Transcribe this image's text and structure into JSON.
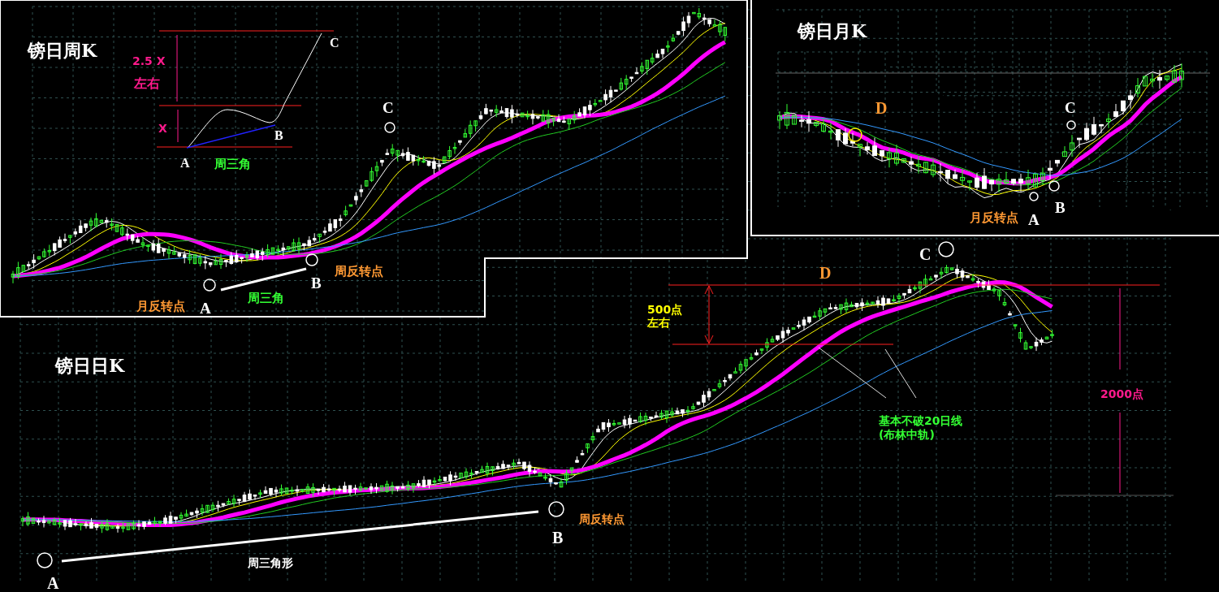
{
  "weekly_chart": {
    "title": "镑日周K",
    "diagram_labels": [
      {
        "text": "2.5 X",
        "color": "#ff1a8c"
      },
      {
        "text": "左右",
        "color": "#ff1a8c"
      },
      {
        "text": "X",
        "color": "#ff1a8c"
      },
      {
        "text": "A",
        "color": "#ffffff"
      },
      {
        "text": "B",
        "color": "#ffffff"
      },
      {
        "text": "C",
        "color": "#ffffff"
      },
      {
        "text": "周三角",
        "color": "#33ff33"
      }
    ],
    "annotations": [
      {
        "text": "C",
        "color": "#ffffff"
      },
      {
        "text": "B",
        "color": "#ffffff"
      },
      {
        "text": "A",
        "color": "#ffffff"
      },
      {
        "text": "周三角",
        "color": "#33ff33"
      },
      {
        "text": "月反转点",
        "color": "#ff9933"
      },
      {
        "text": "周反转点",
        "color": "#ff9933"
      }
    ]
  },
  "monthly_chart": {
    "title": "镑日月K",
    "annotations": [
      {
        "text": "D",
        "color": "#ff9933"
      },
      {
        "text": "C",
        "color": "#ffffff"
      },
      {
        "text": "A",
        "color": "#ffffff"
      },
      {
        "text": "B",
        "color": "#ffffff"
      },
      {
        "text": "月反转点",
        "color": "#ff9933"
      }
    ]
  },
  "daily_chart": {
    "title": "镑日日K",
    "annotations": [
      {
        "text": "D",
        "color": "#ff9933"
      },
      {
        "text": "C",
        "color": "#ffffff"
      },
      {
        "text": "500点",
        "color": "#ffff00"
      },
      {
        "text": "左右",
        "color": "#ffff00"
      },
      {
        "text": "2000点",
        "color": "#ff1a8c"
      },
      {
        "text": "基本不破20日线",
        "color": "#33ff33"
      },
      {
        "text": "(布林中轨)",
        "color": "#33ff33"
      },
      {
        "text": "A",
        "color": "#ffffff"
      },
      {
        "text": "B",
        "color": "#ffffff"
      },
      {
        "text": "周反转点",
        "color": "#ff9933"
      },
      {
        "text": "周三角形",
        "color": "#ffffff"
      }
    ]
  }
}
